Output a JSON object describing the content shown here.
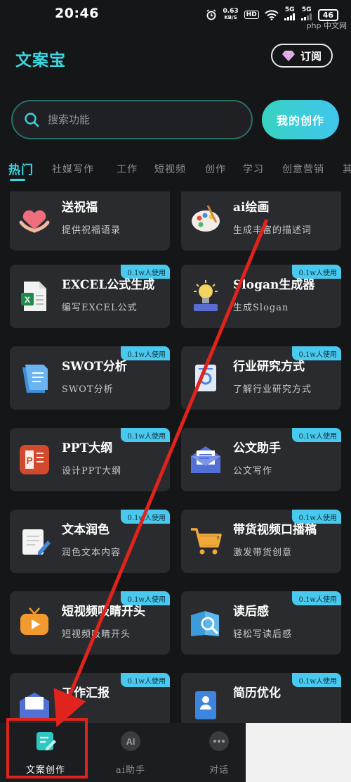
{
  "status": {
    "time": "20:46",
    "speed_value": "0.63",
    "speed_unit": "KB/S",
    "hd": "HD",
    "signal1": "5G",
    "signal2": "5G",
    "battery": "46",
    "watermark": "php 中文网"
  },
  "header": {
    "app_title": "文案宝",
    "subscribe_label": "订阅"
  },
  "search": {
    "placeholder": "搜索功能",
    "my_creation_label": "我的创作"
  },
  "tabs": [
    "热门",
    "社媒写作",
    "工作",
    "短视频",
    "创作",
    "学习",
    "创意营销",
    "其"
  ],
  "cards": [
    {
      "title": "送祝福",
      "desc": "提供祝福语录",
      "icon": "heart-gift-icon",
      "badge": ""
    },
    {
      "title": "ai绘画",
      "desc": "生成丰富的描述词",
      "icon": "paint-palette-icon",
      "badge": ""
    },
    {
      "title": "EXCEL公式生成",
      "desc": "编写EXCEL公式",
      "icon": "excel-icon",
      "badge": "0.1w人使用"
    },
    {
      "title": "Slogan生成器",
      "desc": "生成Slogan",
      "icon": "lightbulb-icon",
      "badge": "0.1w人使用"
    },
    {
      "title": "SWOT分析",
      "desc": "SWOT分析",
      "icon": "document-icon",
      "badge": "0.1w人使用"
    },
    {
      "title": "行业研究方式",
      "desc": "了解行业研究方式",
      "icon": "report-icon",
      "badge": "0.1w人使用"
    },
    {
      "title": "PPT大纲",
      "desc": "设计PPT大纲",
      "icon": "ppt-icon",
      "badge": "0.1w人使用"
    },
    {
      "title": "公文助手",
      "desc": "公文写作",
      "icon": "envelope-icon",
      "badge": "0.1w人使用"
    },
    {
      "title": "文本润色",
      "desc": "润色文本内容",
      "icon": "pen-paper-icon",
      "badge": "0.1w人使用"
    },
    {
      "title": "带货视频口播稿",
      "desc": "激发带货创意",
      "icon": "cart-icon",
      "badge": "0.1w人使用"
    },
    {
      "title": "短视频吸睛开头",
      "desc": "短视频吸睛开头",
      "icon": "tv-play-icon",
      "badge": "0.1w人使用"
    },
    {
      "title": "读后感",
      "desc": "轻松写读后感",
      "icon": "book-search-icon",
      "badge": "0.1w人使用"
    },
    {
      "title": "工作汇报",
      "desc": "",
      "icon": "mail-report-icon",
      "badge": "0.1w人使用"
    },
    {
      "title": "简历优化",
      "desc": "",
      "icon": "resume-icon",
      "badge": "0.1w人使用"
    }
  ],
  "bottom_nav": [
    {
      "label": "文案创作",
      "icon": "edit-doc-icon",
      "active": true
    },
    {
      "label": "ai助手",
      "icon": "ai-icon",
      "active": false
    },
    {
      "label": "对话",
      "icon": "chat-icon",
      "active": false
    }
  ],
  "colors": {
    "accent": "#3cd6e0",
    "badge": "#49c9ee",
    "annotation": "#e0231c",
    "background": "#151618",
    "card": "#2a2b2e"
  }
}
